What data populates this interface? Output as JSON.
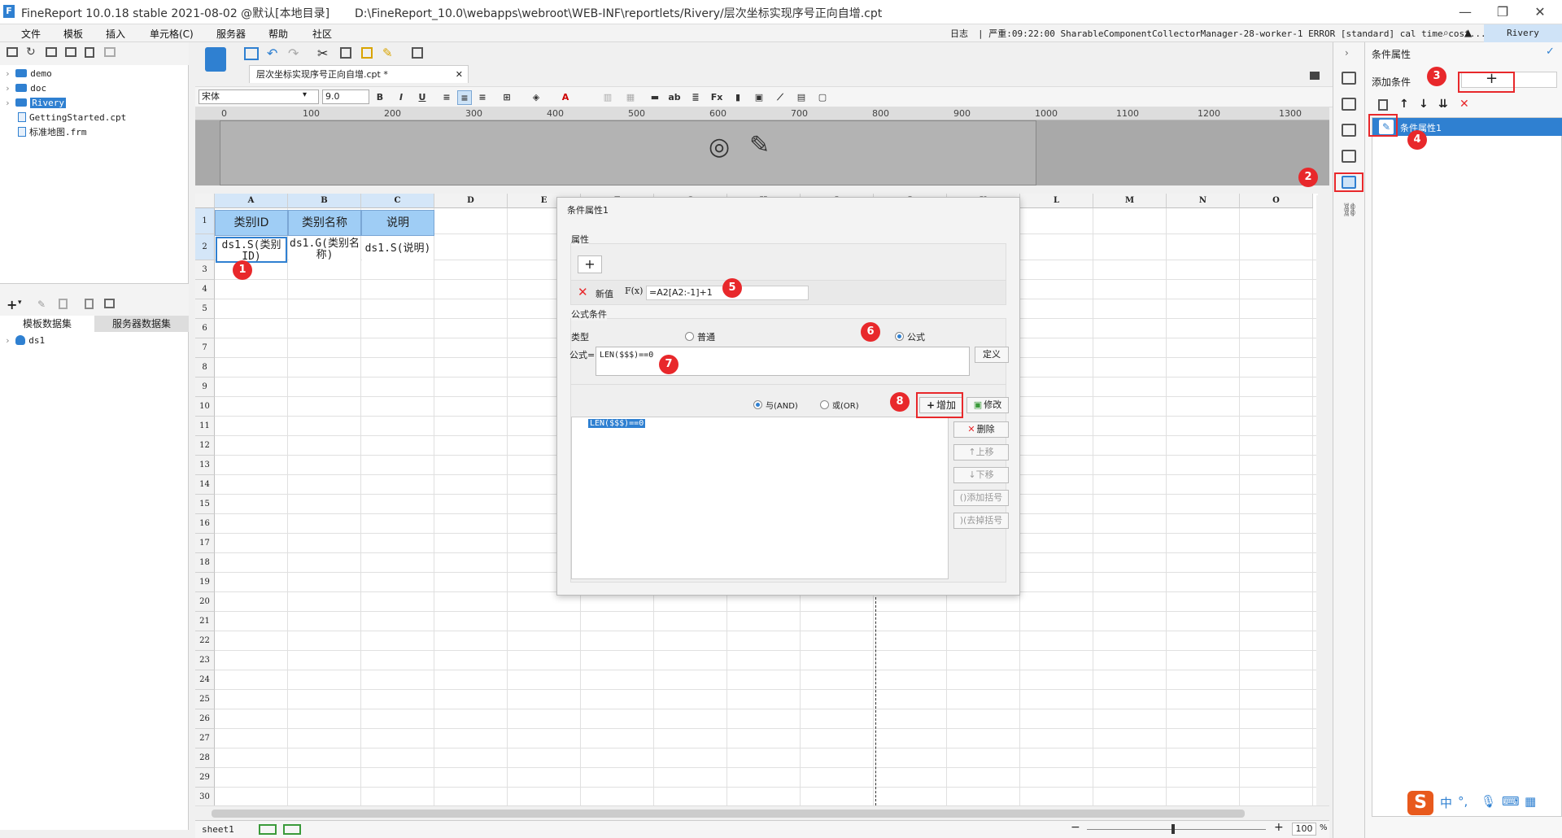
{
  "window": {
    "app_title": "FineReport 10.0.18 stable 2021-08-02 @默认[本地目录]",
    "file_path": "D:\\FineReport_10.0\\webapps\\webroot\\WEB-INF\\reportlets/Rivery/层次坐标实现序号正向自增.cpt",
    "minimize": "—",
    "restore": "❐",
    "close": "✕"
  },
  "menu": [
    "文件",
    "模板",
    "插入",
    "单元格(C)",
    "服务器",
    "帮助",
    "社区"
  ],
  "logbar": {
    "label": "日志",
    "text": "| 严重:09:22:00 SharableComponentCollectorManager-28-worker-1 ERROR [standard] cal time cost...",
    "user": "Rivery"
  },
  "tree": {
    "items": [
      {
        "label": "demo",
        "type": "folder"
      },
      {
        "label": "doc",
        "type": "folder"
      },
      {
        "label": "Rivery",
        "type": "folder",
        "selected": true
      },
      {
        "label": "GettingStarted.cpt",
        "type": "file"
      },
      {
        "label": "标准地图.frm",
        "type": "file"
      }
    ]
  },
  "datasets": {
    "tabs": [
      "模板数据集",
      "服务器数据集"
    ],
    "items": [
      "ds1"
    ]
  },
  "editor": {
    "tab_label": "层次坐标实现序号正向自增.cpt *",
    "tab_close": "✕",
    "font_name": "宋体",
    "font_size": "9.0"
  },
  "ruler": [
    "0",
    "100",
    "200",
    "300",
    "400",
    "500",
    "600",
    "700",
    "800",
    "900",
    "1000",
    "1100",
    "1200",
    "1300"
  ],
  "grid": {
    "columns": [
      "A",
      "B",
      "C",
      "D",
      "E",
      "F",
      "G",
      "H",
      "I",
      "J",
      "K",
      "L",
      "M",
      "N",
      "O"
    ],
    "rows": [
      "1",
      "2",
      "3",
      "4",
      "5",
      "6",
      "7",
      "8",
      "9",
      "10",
      "11",
      "12",
      "13",
      "14",
      "15",
      "16",
      "17",
      "18",
      "19",
      "20",
      "21",
      "22",
      "23",
      "24",
      "25",
      "26",
      "27",
      "28",
      "29",
      "30"
    ],
    "header_cells": [
      "类别ID",
      "类别名称",
      "说明"
    ],
    "data_cells": [
      "ds1.S(类别ID)",
      "ds1.G(类别名称)",
      "ds1.S(说明)"
    ]
  },
  "sheet": {
    "name": "sheet1",
    "zoom": "100",
    "zoom_unit": "%"
  },
  "right_panel": {
    "title": "条件属性",
    "add_label": "添加条件",
    "add_btn": "+",
    "item": "条件属性1"
  },
  "dialog": {
    "title": "条件属性1",
    "attr_section": "属性",
    "new_value_label": "新值",
    "new_value": "=A2[A2:-1]+1",
    "formula_section": "公式条件",
    "type_label": "类型",
    "type_normal": "普通",
    "type_formula": "公式",
    "formula_label": "公式=",
    "formula_value": "LEN($$$)==0",
    "define_btn": "定义",
    "and_label": "与(AND)",
    "or_label": "或(OR)",
    "add_btn": "增加",
    "modify_btn": "修改",
    "delete_btn": "删除",
    "up_btn": "上移",
    "down_btn": "下移",
    "add_bracket_btn": "添加括号",
    "remove_bracket_btn": "去掉括号",
    "list_items": [
      "LEN($$$)==0"
    ]
  },
  "markers": [
    "1",
    "2",
    "3",
    "4",
    "5",
    "6",
    "7",
    "8"
  ],
  "colors": {
    "accent": "#2f80d1",
    "header_cell": "#9fcdf5",
    "marker": "#e8282b"
  }
}
